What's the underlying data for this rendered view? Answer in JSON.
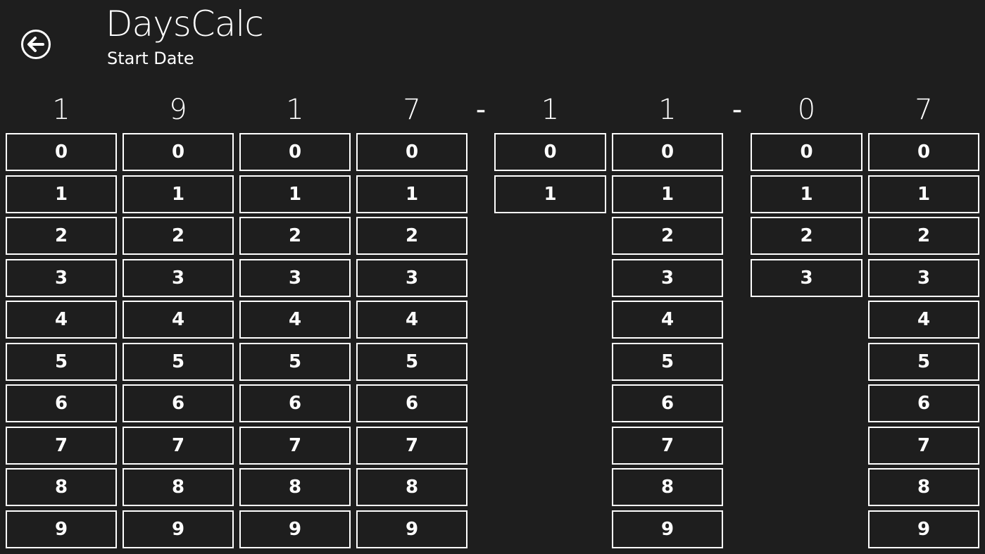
{
  "header": {
    "title": "DaysCalc",
    "subtitle": "Start Date",
    "back_icon": "back-arrow-icon"
  },
  "date_display": {
    "digits": [
      "1",
      "9",
      "1",
      "7",
      "1",
      "1",
      "0",
      "7"
    ],
    "separator": "-"
  },
  "pickers": [
    {
      "options": [
        "0",
        "1",
        "2",
        "3",
        "4",
        "5",
        "6",
        "7",
        "8",
        "9"
      ]
    },
    {
      "options": [
        "0",
        "1",
        "2",
        "3",
        "4",
        "5",
        "6",
        "7",
        "8",
        "9"
      ]
    },
    {
      "options": [
        "0",
        "1",
        "2",
        "3",
        "4",
        "5",
        "6",
        "7",
        "8",
        "9"
      ]
    },
    {
      "options": [
        "0",
        "1",
        "2",
        "3",
        "4",
        "5",
        "6",
        "7",
        "8",
        "9"
      ]
    },
    {
      "options": [
        "0",
        "1"
      ]
    },
    {
      "options": [
        "0",
        "1",
        "2",
        "3",
        "4",
        "5",
        "6",
        "7",
        "8",
        "9"
      ]
    },
    {
      "options": [
        "0",
        "1",
        "2",
        "3"
      ]
    },
    {
      "options": [
        "0",
        "1",
        "2",
        "3",
        "4",
        "5",
        "6",
        "7",
        "8",
        "9"
      ]
    }
  ]
}
